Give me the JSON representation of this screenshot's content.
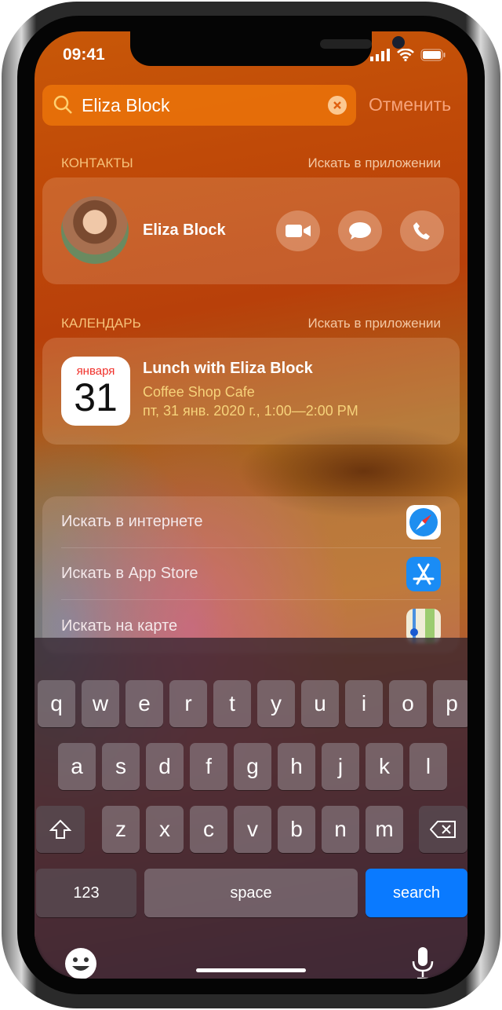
{
  "status": {
    "time": "09:41"
  },
  "search": {
    "value": "Eliza Block",
    "cancel": "Отменить"
  },
  "contacts": {
    "header": "КОНТАКТЫ",
    "search_in_app": "Искать в приложении",
    "name": "Eliza Block"
  },
  "calendar": {
    "header": "КАЛЕНДАРЬ",
    "search_in_app": "Искать в приложении",
    "month": "января",
    "day": "31",
    "title": "Lunch with Eliza Block",
    "location": "Coffee Shop Cafe",
    "datetime": "пт, 31 янв. 2020 г., 1:00—2:00 PM"
  },
  "suggestions": [
    {
      "label": "Искать в интернете",
      "icon": "safari-icon"
    },
    {
      "label": "Искать в App Store",
      "icon": "app-store-icon"
    },
    {
      "label": "Искать на карте",
      "icon": "maps-icon"
    }
  ],
  "keyboard": {
    "row1": [
      "q",
      "w",
      "e",
      "r",
      "t",
      "y",
      "u",
      "i",
      "o",
      "p"
    ],
    "row2": [
      "a",
      "s",
      "d",
      "f",
      "g",
      "h",
      "j",
      "k",
      "l"
    ],
    "row3": [
      "z",
      "x",
      "c",
      "v",
      "b",
      "n",
      "m"
    ],
    "numbers": "123",
    "space": "space",
    "search": "search",
    "search_color": "#0a7aff"
  },
  "colors": {
    "accent": "#f6c27a",
    "event_sub": "#f6d27a",
    "cal_month": "#f0302a"
  }
}
